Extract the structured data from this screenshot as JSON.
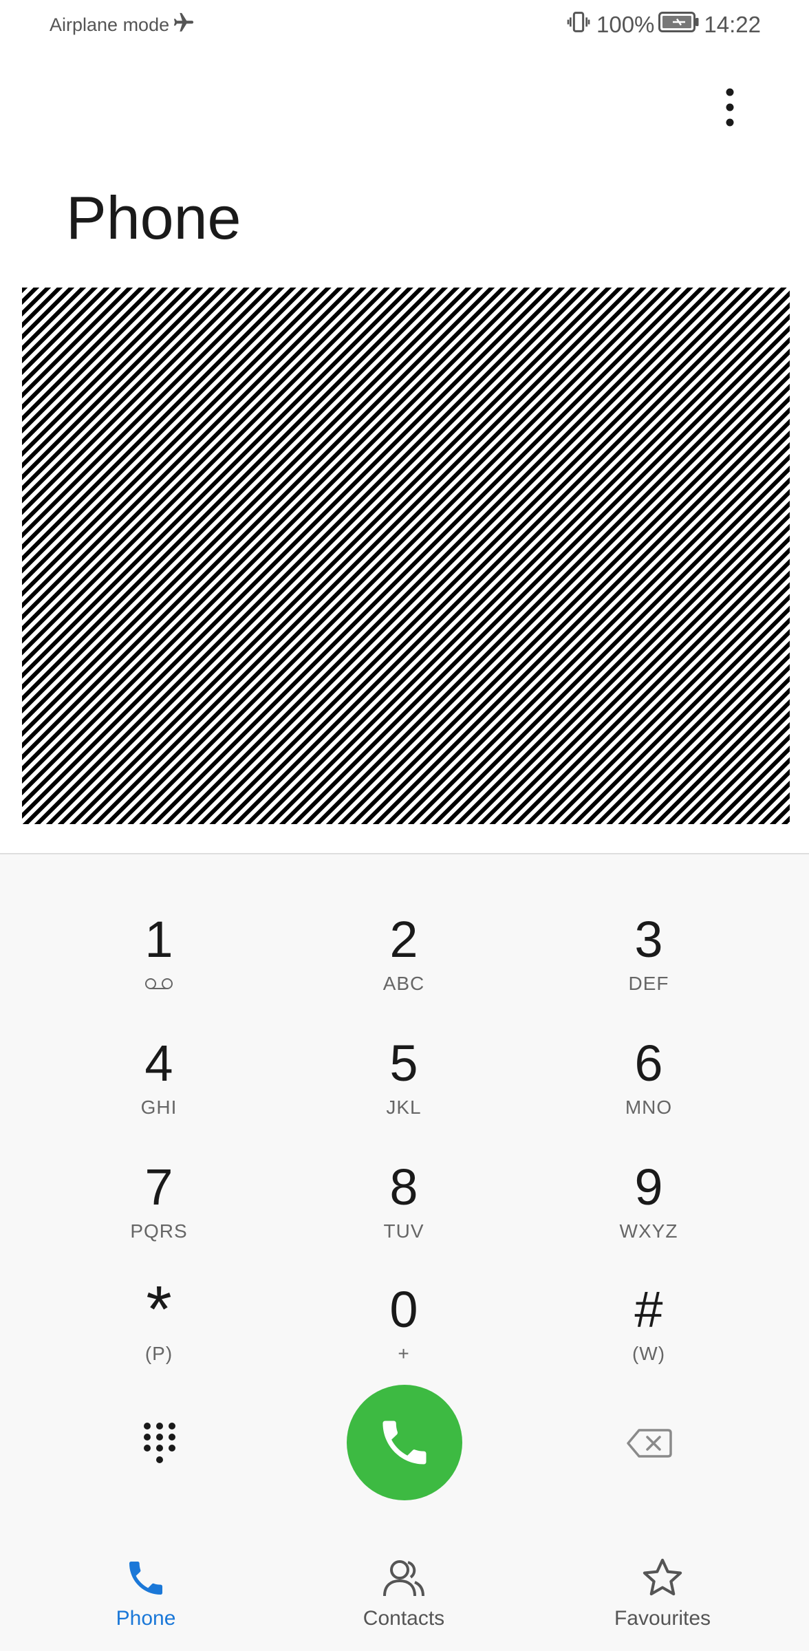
{
  "status_bar": {
    "left_text": "Airplane mode",
    "battery_text": "100%",
    "time": "14:22",
    "icons": [
      "airplane-icon",
      "vibrate-icon",
      "battery-charging-icon"
    ]
  },
  "app_bar": {
    "title": "Phone",
    "more_icon": "more-vert-icon"
  },
  "dialpad": {
    "keys": [
      {
        "digit": "1",
        "letters": "",
        "letters_icon": "voicemail-icon"
      },
      {
        "digit": "2",
        "letters": "ABC"
      },
      {
        "digit": "3",
        "letters": "DEF"
      },
      {
        "digit": "4",
        "letters": "GHI"
      },
      {
        "digit": "5",
        "letters": "JKL"
      },
      {
        "digit": "6",
        "letters": "MNO"
      },
      {
        "digit": "7",
        "letters": "PQRS"
      },
      {
        "digit": "8",
        "letters": "TUV"
      },
      {
        "digit": "9",
        "letters": "WXYZ"
      },
      {
        "digit": "*",
        "letters": "(P)"
      },
      {
        "digit": "0",
        "letters": "+"
      },
      {
        "digit": "#",
        "letters": "(W)"
      }
    ],
    "actions": {
      "keypad_icon": "dialpad-icon",
      "call_icon": "phone-icon",
      "delete_icon": "backspace-icon"
    }
  },
  "bottom_nav": {
    "items": [
      {
        "label": "Phone",
        "icon": "phone-icon",
        "active": true
      },
      {
        "label": "Contacts",
        "icon": "contacts-icon",
        "active": false
      },
      {
        "label": "Favourites",
        "icon": "star-icon",
        "active": false
      }
    ]
  },
  "colors": {
    "accent": "#1b78d8",
    "call_green": "#3dba42",
    "dialpad_background": "#f8f8f8"
  }
}
